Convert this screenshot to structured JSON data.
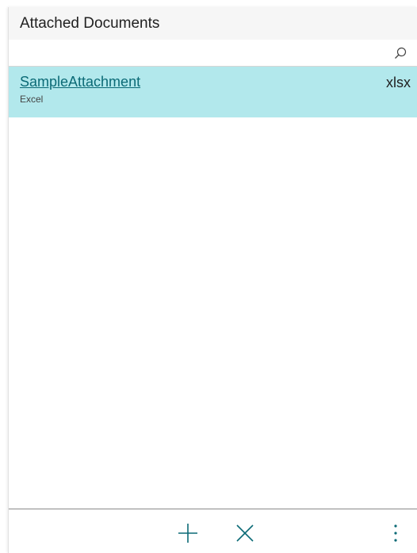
{
  "panel": {
    "title": "Attached Documents"
  },
  "search": {
    "icon": "search-icon"
  },
  "documents": [
    {
      "name": "SampleAttachment",
      "type": "Excel",
      "extension": "xlsx"
    }
  ],
  "toolbar": {
    "add_icon": "plus-icon",
    "remove_icon": "close-icon",
    "more_icon": "more-vertical-icon"
  },
  "colors": {
    "accent": "#0b6a76",
    "selected_row": "#b2e8ec",
    "header_bg": "#f6f6f6"
  }
}
